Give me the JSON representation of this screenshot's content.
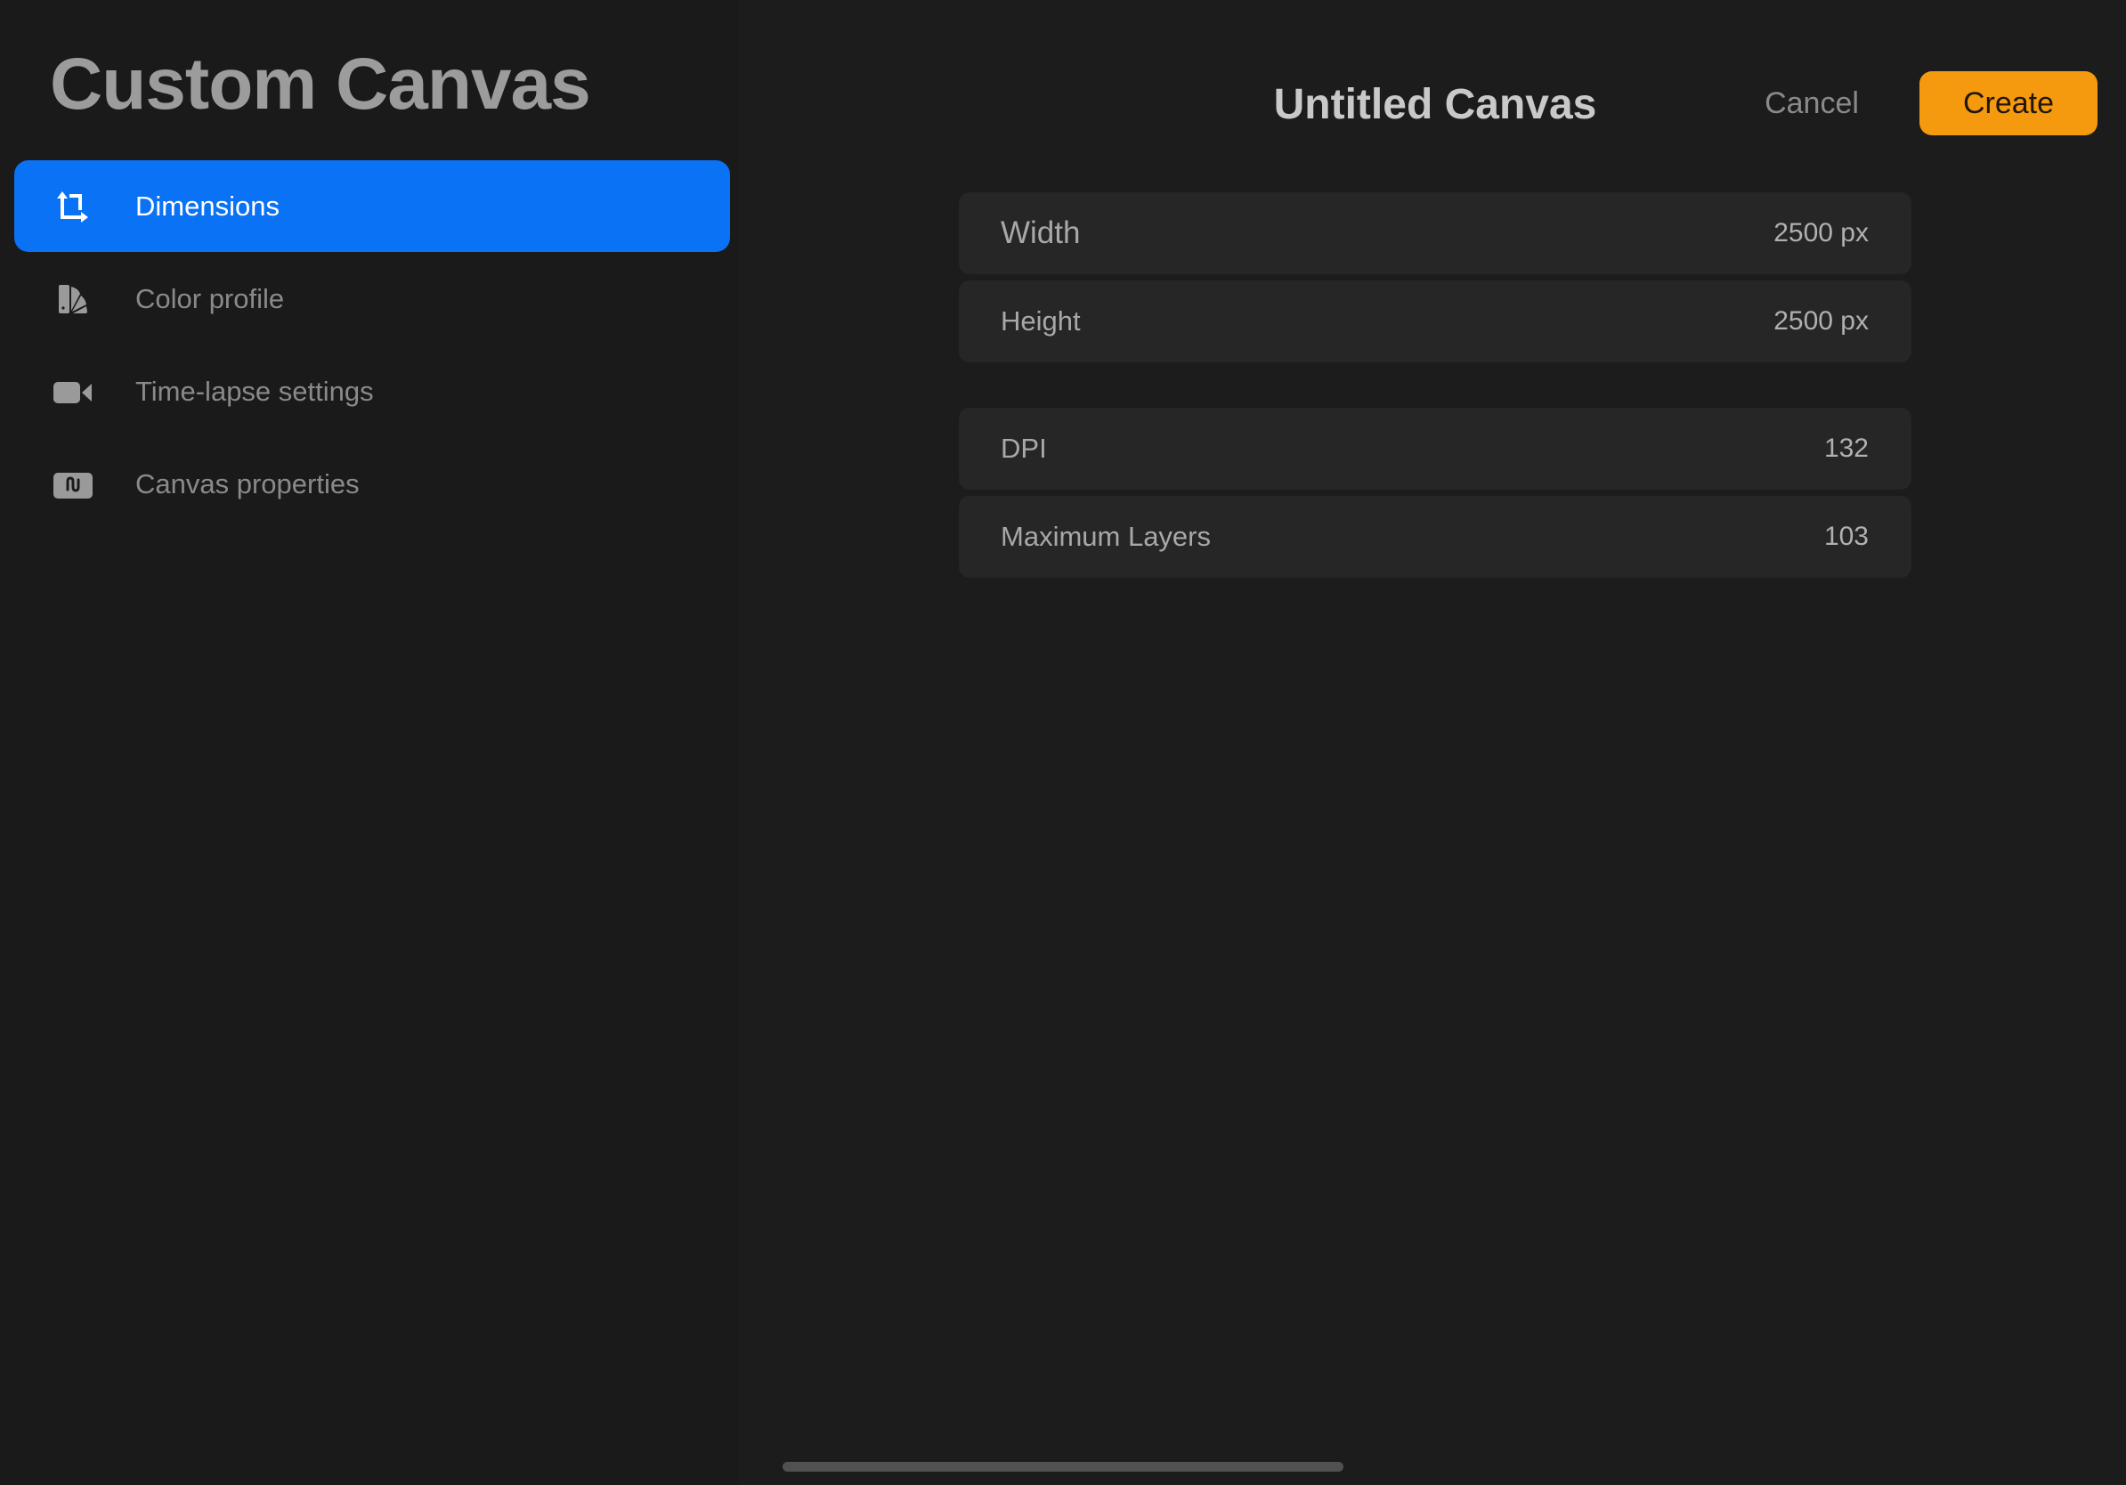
{
  "sidebar": {
    "title": "Custom Canvas",
    "items": [
      {
        "label": "Dimensions",
        "icon": "dimensions-icon",
        "active": true
      },
      {
        "label": "Color profile",
        "icon": "color-profile-icon",
        "active": false
      },
      {
        "label": "Time-lapse settings",
        "icon": "video-camera-icon",
        "active": false
      },
      {
        "label": "Canvas properties",
        "icon": "canvas-properties-icon",
        "active": false
      }
    ]
  },
  "header": {
    "canvas_name": "Untitled Canvas",
    "cancel_label": "Cancel",
    "create_label": "Create"
  },
  "dimensions": {
    "rows": [
      {
        "label": "Width",
        "value": "2500 px"
      },
      {
        "label": "Height",
        "value": "2500 px"
      },
      {
        "label": "DPI",
        "value": "132"
      },
      {
        "label": "Maximum Layers",
        "value": "103"
      }
    ]
  },
  "colors": {
    "accent_blue": "#0a72f5",
    "create_orange": "#f59a0e",
    "background": "#1c1c1c"
  }
}
